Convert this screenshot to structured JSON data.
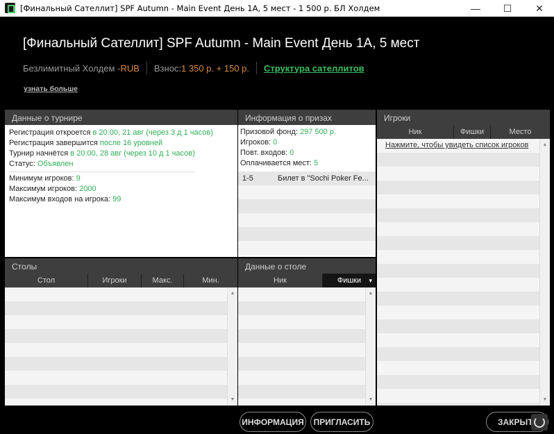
{
  "window": {
    "title": "[Финальный Сателлит] SPF Autumn - Main Event День 1А, 5 мест - 1 500 р. БЛ Холдем",
    "controls": {
      "minimize": "—",
      "maximize": "☐",
      "close": "✕"
    }
  },
  "header": {
    "title": "[Финальный Сателлит] SPF Autumn - Main Event День 1А, 5 мест",
    "game_type": "Безлимитный Холдем - ",
    "currency": "RUB",
    "buyin_label": "Взнос: ",
    "buyin_value": "1 350 р. + 150 р.",
    "satellite_link": "Структура сателлитов",
    "learn_more": "узнать больше"
  },
  "tournament_panel": {
    "title": "Данные о турнире",
    "reg_opens_label": "Регистрация откроется ",
    "reg_opens_value": "в 20:00, 21 авг (через 3 д 1 часов)",
    "reg_closes_label": "Регистрация завершится ",
    "reg_closes_value": "после 16 уровней",
    "starts_label": "Турнир начнётся ",
    "starts_value": "в 20:00, 28 авг (через 10 д 1 часов)",
    "status_label": "Статус: ",
    "status_value": "Объявлен",
    "min_players_label": "Минимум игроков: ",
    "min_players_value": "9",
    "max_players_label": "Максимум игроков: ",
    "max_players_value": "2000",
    "max_entries_label": "Максимум входов на игрока: ",
    "max_entries_value": "99"
  },
  "prize_panel": {
    "title": "Информация о призах",
    "pool_label": "Призовой фонд: ",
    "pool_value": "297 500 р.",
    "players_label": "Игроков: ",
    "players_value": "0",
    "reentries_label": "Повт. входов: ",
    "reentries_value": "0",
    "paid_label": "Оплачивается мест: ",
    "paid_value": "5",
    "payouts": [
      {
        "places": "1-5",
        "prize": "Билет в \"Sochi Poker Fe..."
      }
    ]
  },
  "players_panel": {
    "title": "Игроки",
    "columns": [
      "Ник",
      "Фишки",
      "Место"
    ],
    "show_list_link": "Нажмите, чтобы увидеть список игроков"
  },
  "tables_panel": {
    "title": "Столы",
    "columns": [
      "Стол",
      "Игроки",
      "Макс.",
      "Мин."
    ]
  },
  "table_data_panel": {
    "title": "Данные о столе",
    "columns": [
      "Ник",
      "Фишки"
    ],
    "sort_indicator": "▾"
  },
  "buttons": {
    "info": "ИНФОРМАЦИЯ",
    "invite": "ПРИГЛАСИТЬ",
    "close": "ЗАКРЫТЬ"
  }
}
